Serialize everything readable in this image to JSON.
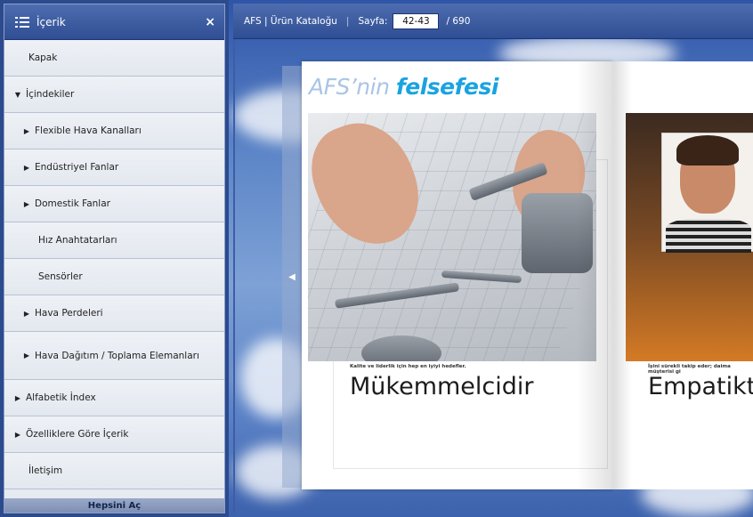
{
  "sidebar": {
    "title": "İçerik",
    "close_label": "×",
    "expand_all_label": "Hepsini Aç",
    "items": [
      {
        "label": "Kapak",
        "level": 0,
        "arrow": ""
      },
      {
        "label": "İçindekiler",
        "level": 0,
        "arrow": "▼"
      },
      {
        "label": "Flexible Hava Kanalları",
        "level": 1,
        "arrow": "▶"
      },
      {
        "label": "Endüstriyel Fanlar",
        "level": 1,
        "arrow": "▶"
      },
      {
        "label": "Domestik Fanlar",
        "level": 1,
        "arrow": "▶"
      },
      {
        "label": "Hız Anahtatarları",
        "level": 1,
        "arrow": ""
      },
      {
        "label": "Sensörler",
        "level": 1,
        "arrow": ""
      },
      {
        "label": "Hava Perdeleri",
        "level": 1,
        "arrow": "▶"
      },
      {
        "label": "Hava Dağıtım / Toplama Elemanları",
        "level": 1,
        "arrow": "▶"
      },
      {
        "label": "Alfabetik İndex",
        "level": 0,
        "arrow": "▶"
      },
      {
        "label": "Özelliklere Göre İçerik",
        "level": 0,
        "arrow": "▶"
      },
      {
        "label": "İletişim",
        "level": 0,
        "arrow": ""
      }
    ]
  },
  "toolbar": {
    "catalog_title": "AFS | Ürün Kataloğu",
    "separator": "|",
    "page_label": "Sayfa:",
    "page_value": "42-43",
    "page_total": "/ 690"
  },
  "viewer": {
    "prev_arrow": "◀",
    "left_page": {
      "heading_part1": "AFS’nin ",
      "heading_part2": "felsefesi",
      "caption": "Kalite ve liderlik için hep en iyiyi hedefler.",
      "big_word": "Mükemmelcidir"
    },
    "right_page": {
      "caption": "İşini sürekli takip eder; daima müşterisi gi",
      "big_word": "Empatikt"
    }
  }
}
